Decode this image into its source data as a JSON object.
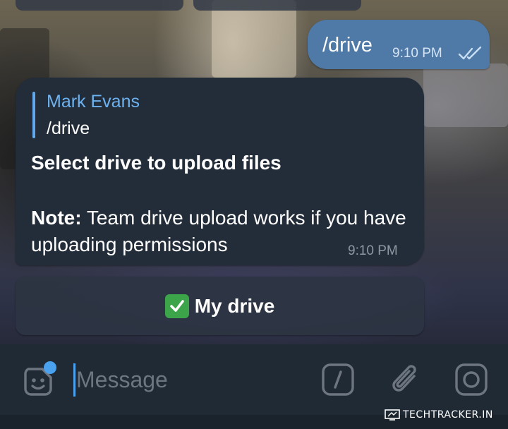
{
  "outgoing": {
    "text": "/drive",
    "time": "9:10 PM",
    "status_icon": "double-check-icon"
  },
  "incoming": {
    "reply_to": {
      "name": "Mark Evans",
      "text": "/drive"
    },
    "heading": "Select drive to upload files",
    "note_label": "Note:",
    "note_text": " Team drive upload works if you have uploading permissions",
    "time": "9:10 PM"
  },
  "inline_keyboard": {
    "button_icon": "check-mark-emoji",
    "button_label": "My drive"
  },
  "input_bar": {
    "placeholder": "Message",
    "value": "",
    "icons": [
      "sticker-icon",
      "bot-command-icon",
      "attach-icon",
      "camera-icon"
    ]
  },
  "watermark": {
    "text": "TECHTRACKER.IN"
  },
  "colors": {
    "outgoing_bubble": "#4f79a6",
    "incoming_bubble": "#232d39",
    "accent": "#4aa2ef",
    "reply_name": "#6db2f0"
  }
}
